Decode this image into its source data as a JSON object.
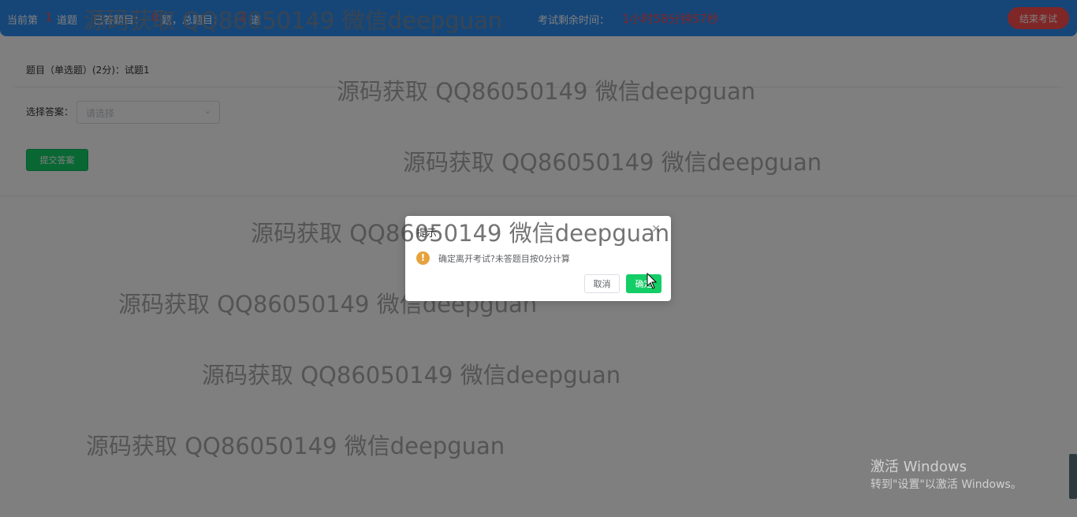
{
  "topbar": {
    "prefix": "当前第",
    "current": "1",
    "mid1": "道题",
    "mid2": "已答题目：",
    "answered": "0",
    "mid3": "题，总题目：",
    "total": "3",
    "mid4": "道",
    "remain_label": "考试剩余时间：",
    "remain_value": "1小时58分钟57秒",
    "end_label": "结束考试"
  },
  "question": {
    "title": "题目（单选题）(2分)：试题1",
    "answer_label": "选择答案：",
    "select_placeholder": "请选择",
    "submit_label": "提交答案"
  },
  "watermark": {
    "text": "源码获取 QQ86050149 微信deepguan"
  },
  "dialog": {
    "title": "提示",
    "message": "确定离开考试?未答题目按0分计算",
    "cancel": "取消",
    "confirm": "确定"
  },
  "windows": {
    "line1": "激活 Windows",
    "line2": "转到\"设置\"以激活 Windows。"
  },
  "colors": {
    "primary": "#2d8cf0",
    "danger": "#ff4d4f",
    "success": "#13ce66",
    "warning": "#e6a23c"
  }
}
